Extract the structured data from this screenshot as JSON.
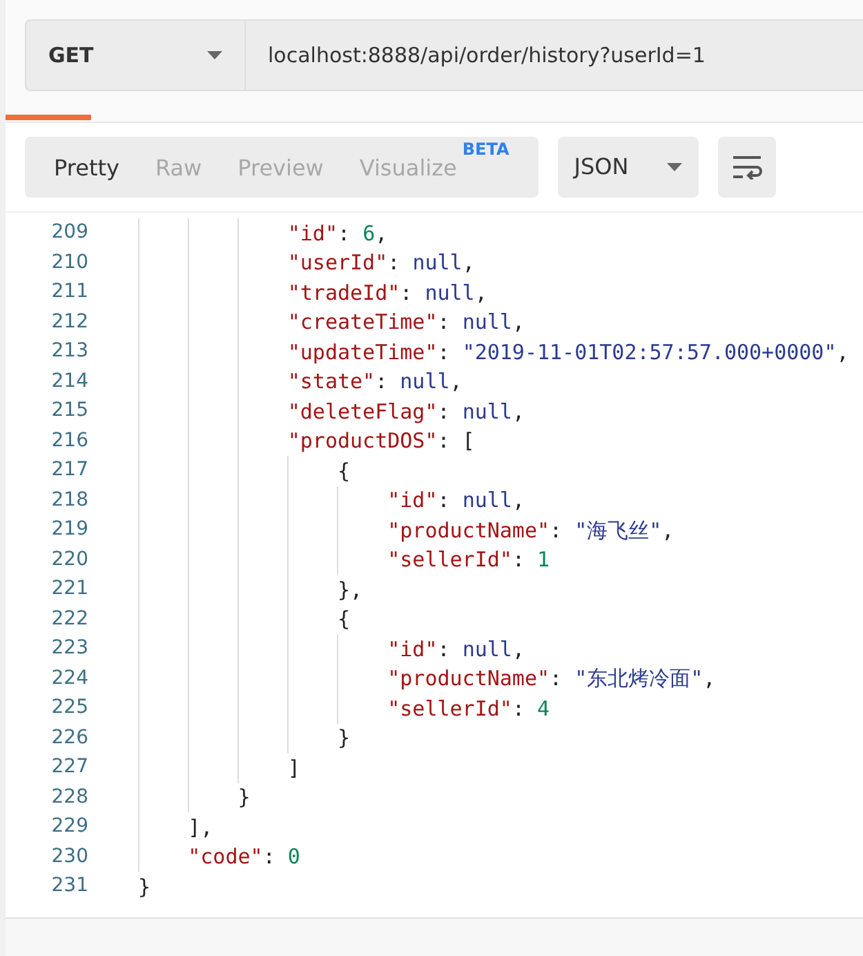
{
  "request": {
    "method": "GET",
    "url": "localhost:8888/api/order/history?userId=1"
  },
  "view_tabs": [
    {
      "label": "Pretty",
      "selected": true
    },
    {
      "label": "Raw",
      "selected": false
    },
    {
      "label": "Preview",
      "selected": false
    },
    {
      "label": "Visualize",
      "badge": "BETA",
      "selected": false
    }
  ],
  "format_select": {
    "value": "JSON"
  },
  "code_lines": [
    {
      "number": "209",
      "tokens": [
        {
          "kind": "key",
          "text": "            \"id\""
        },
        {
          "kind": "punct",
          "text": ": "
        },
        {
          "kind": "number",
          "text": "6"
        },
        {
          "kind": "punct",
          "text": ","
        }
      ]
    },
    {
      "number": "210",
      "tokens": [
        {
          "kind": "key",
          "text": "            \"userId\""
        },
        {
          "kind": "punct",
          "text": ": "
        },
        {
          "kind": "null",
          "text": "null"
        },
        {
          "kind": "punct",
          "text": ","
        }
      ]
    },
    {
      "number": "211",
      "tokens": [
        {
          "kind": "key",
          "text": "            \"tradeId\""
        },
        {
          "kind": "punct",
          "text": ": "
        },
        {
          "kind": "null",
          "text": "null"
        },
        {
          "kind": "punct",
          "text": ","
        }
      ]
    },
    {
      "number": "212",
      "tokens": [
        {
          "kind": "key",
          "text": "            \"createTime\""
        },
        {
          "kind": "punct",
          "text": ": "
        },
        {
          "kind": "null",
          "text": "null"
        },
        {
          "kind": "punct",
          "text": ","
        }
      ]
    },
    {
      "number": "213",
      "tokens": [
        {
          "kind": "key",
          "text": "            \"updateTime\""
        },
        {
          "kind": "punct",
          "text": ": "
        },
        {
          "kind": "string",
          "text": "\"2019-11-01T02:57:57.000+0000\""
        },
        {
          "kind": "punct",
          "text": ","
        }
      ]
    },
    {
      "number": "214",
      "tokens": [
        {
          "kind": "key",
          "text": "            \"state\""
        },
        {
          "kind": "punct",
          "text": ": "
        },
        {
          "kind": "null",
          "text": "null"
        },
        {
          "kind": "punct",
          "text": ","
        }
      ]
    },
    {
      "number": "215",
      "tokens": [
        {
          "kind": "key",
          "text": "            \"deleteFlag\""
        },
        {
          "kind": "punct",
          "text": ": "
        },
        {
          "kind": "null",
          "text": "null"
        },
        {
          "kind": "punct",
          "text": ","
        }
      ]
    },
    {
      "number": "216",
      "tokens": [
        {
          "kind": "key",
          "text": "            \"productDOS\""
        },
        {
          "kind": "punct",
          "text": ": ["
        }
      ]
    },
    {
      "number": "217",
      "tokens": [
        {
          "kind": "punct",
          "text": "                {"
        }
      ]
    },
    {
      "number": "218",
      "tokens": [
        {
          "kind": "key",
          "text": "                    \"id\""
        },
        {
          "kind": "punct",
          "text": ": "
        },
        {
          "kind": "null",
          "text": "null"
        },
        {
          "kind": "punct",
          "text": ","
        }
      ]
    },
    {
      "number": "219",
      "tokens": [
        {
          "kind": "key",
          "text": "                    \"productName\""
        },
        {
          "kind": "punct",
          "text": ": "
        },
        {
          "kind": "string",
          "text": "\"海飞丝\""
        },
        {
          "kind": "punct",
          "text": ","
        }
      ]
    },
    {
      "number": "220",
      "tokens": [
        {
          "kind": "key",
          "text": "                    \"sellerId\""
        },
        {
          "kind": "punct",
          "text": ": "
        },
        {
          "kind": "number",
          "text": "1"
        }
      ]
    },
    {
      "number": "221",
      "tokens": [
        {
          "kind": "punct",
          "text": "                },"
        }
      ]
    },
    {
      "number": "222",
      "tokens": [
        {
          "kind": "punct",
          "text": "                {"
        }
      ]
    },
    {
      "number": "223",
      "tokens": [
        {
          "kind": "key",
          "text": "                    \"id\""
        },
        {
          "kind": "punct",
          "text": ": "
        },
        {
          "kind": "null",
          "text": "null"
        },
        {
          "kind": "punct",
          "text": ","
        }
      ]
    },
    {
      "number": "224",
      "tokens": [
        {
          "kind": "key",
          "text": "                    \"productName\""
        },
        {
          "kind": "punct",
          "text": ": "
        },
        {
          "kind": "string",
          "text": "\"东北烤冷面\""
        },
        {
          "kind": "punct",
          "text": ","
        }
      ]
    },
    {
      "number": "225",
      "tokens": [
        {
          "kind": "key",
          "text": "                    \"sellerId\""
        },
        {
          "kind": "punct",
          "text": ": "
        },
        {
          "kind": "number",
          "text": "4"
        }
      ]
    },
    {
      "number": "226",
      "tokens": [
        {
          "kind": "punct",
          "text": "                }"
        }
      ]
    },
    {
      "number": "227",
      "tokens": [
        {
          "kind": "punct",
          "text": "            ]"
        }
      ]
    },
    {
      "number": "228",
      "tokens": [
        {
          "kind": "punct",
          "text": "        }"
        }
      ]
    },
    {
      "number": "229",
      "tokens": [
        {
          "kind": "punct",
          "text": "    ],"
        }
      ]
    },
    {
      "number": "230",
      "tokens": [
        {
          "kind": "key",
          "text": "    \"code\""
        },
        {
          "kind": "punct",
          "text": ": "
        },
        {
          "kind": "number",
          "text": "0"
        }
      ]
    },
    {
      "number": "231",
      "tokens": [
        {
          "kind": "punct",
          "text": "}"
        }
      ]
    }
  ]
}
